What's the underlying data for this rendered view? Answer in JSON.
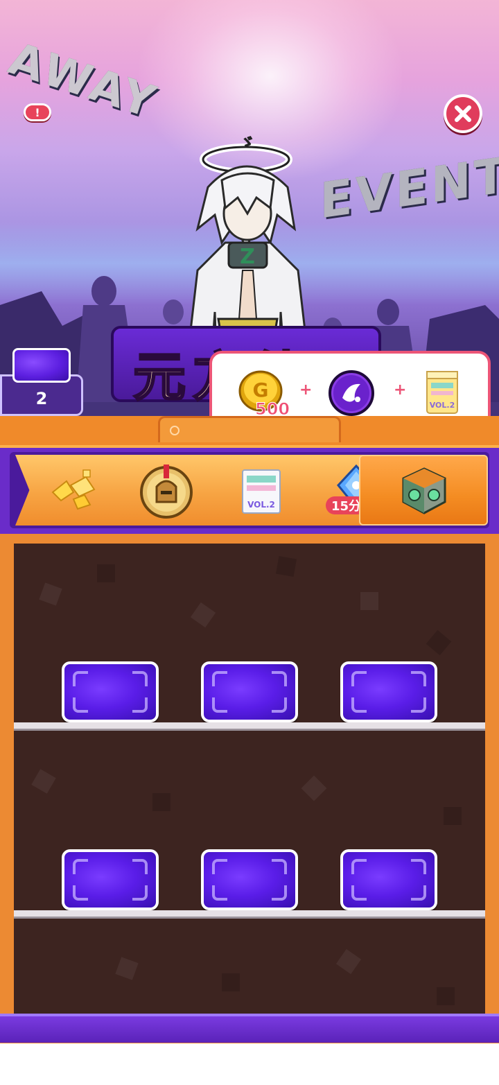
{
  "hero": {
    "alert_label": "!",
    "character_title": "元方徒",
    "graffiti_left": "AWAY",
    "graffiti_right": "EVENT",
    "halo_glyph": "ゞ"
  },
  "card_counter": {
    "count": "2"
  },
  "reward_popup": {
    "items": [
      {
        "icon": "gold-coin-icon",
        "amount": "500"
      },
      {
        "icon": "purple-orb-icon"
      },
      {
        "icon": "juice-box-icon"
      }
    ],
    "separator": "+"
  },
  "reward_track": {
    "steps": [
      {
        "icon": "gold-crystals-icon"
      },
      {
        "icon": "spartan-medal-icon"
      },
      {
        "icon": "drink-box-icon"
      },
      {
        "icon": "blue-gem-timer-icon",
        "badge": "15分"
      },
      {
        "icon": "treasure-cube-icon"
      }
    ]
  },
  "shelves": {
    "rows": 2,
    "cards_per_row": 3
  },
  "colors": {
    "accent_orange": "#f08a2a",
    "purple": "#6a2cc9",
    "card_purple": "#5a1de8",
    "close_red": "#e03c5c",
    "popup_border": "#ec5577"
  }
}
